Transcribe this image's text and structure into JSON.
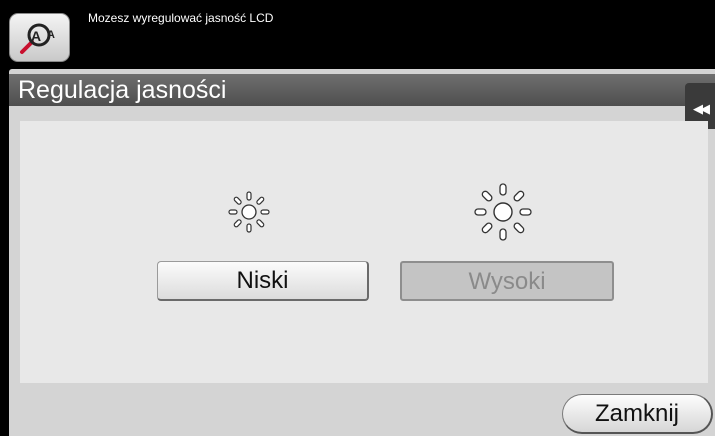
{
  "topbar": {
    "message": "Mozesz wyregulować jasność LCD",
    "zoom_icon": "magnify-text-icon"
  },
  "dialog": {
    "title": "Regulacja jasności",
    "collapse_icon": "double-chevron-left-icon",
    "collapse_glyph": "◀◀",
    "icons": [
      "brightness-low-icon",
      "brightness-high-icon"
    ],
    "options": [
      {
        "label": "Niski",
        "selected": false
      },
      {
        "label": "Wysoki",
        "selected": true
      }
    ],
    "close_label": "Zamknij"
  },
  "colors": {
    "topbar": "#000000",
    "panel": "#d4d4d4",
    "title_bar": "#5a5a5a",
    "selected_button": "#c4c4c4"
  }
}
